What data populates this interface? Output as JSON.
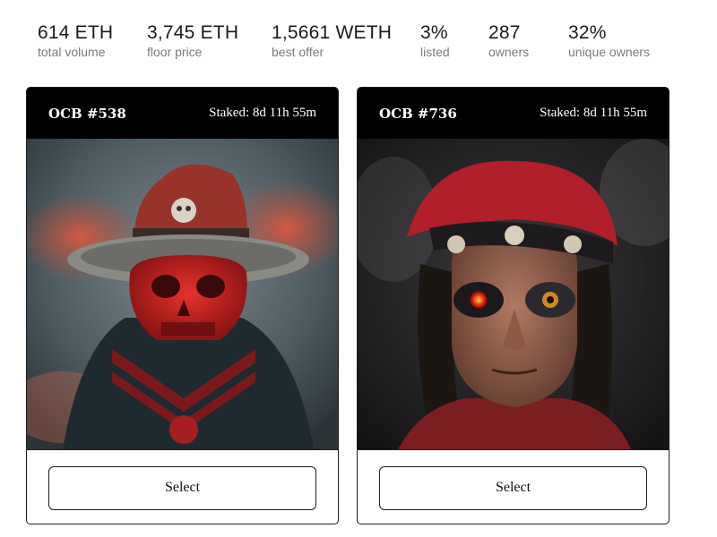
{
  "stats": [
    {
      "value": "614 ETH",
      "label": "total volume"
    },
    {
      "value": "3,745 ETH",
      "label": "floor price"
    },
    {
      "value": "1,5661 WETH",
      "label": "best offer"
    },
    {
      "value": "3%",
      "label": "listed"
    },
    {
      "value": "287",
      "label": "owners"
    },
    {
      "value": "32%",
      "label": "unique owners"
    }
  ],
  "cards": [
    {
      "name": "OCB #538",
      "staked": "Staked: 8d 11h 55m",
      "select_label": "Select",
      "image_icon": "red-skull-pirate-portrait"
    },
    {
      "name": "OCB #736",
      "staked": "Staked: 8d 11h 55m",
      "select_label": "Select",
      "image_icon": "pirate-with-bandana-portrait"
    }
  ],
  "colors": {
    "header_bg": "#000000",
    "accent_red": "#c0282a"
  }
}
